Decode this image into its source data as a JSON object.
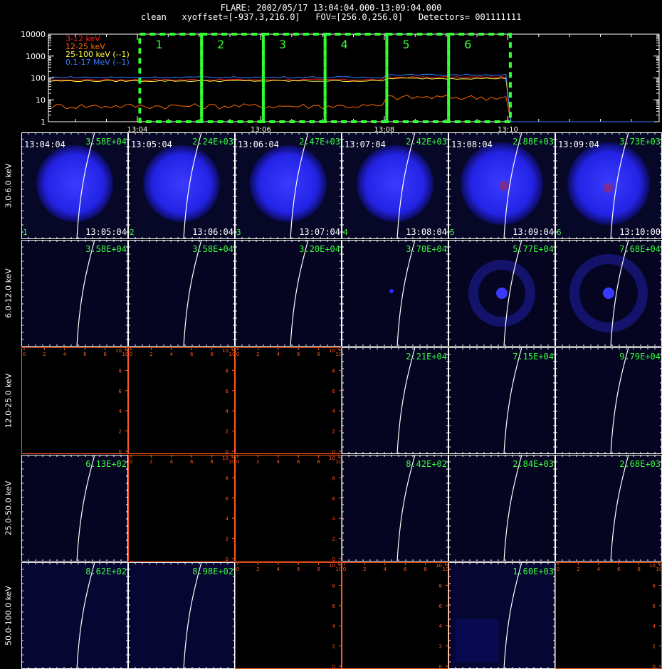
{
  "header": {
    "line1": "FLARE: 2002/05/17 13:04:04.000-13:09:04.000",
    "line2": "clean   xyoffset=[-937.3,216.0]   FOV=[256.0,256.0]   Detectors= 001111111"
  },
  "chart_data": [
    {
      "type": "line",
      "title": "",
      "ylabel": "",
      "yscale": "log",
      "ylim": [
        1,
        10000
      ],
      "y_ticks": [
        "1",
        "10",
        "100",
        "1000",
        "10000"
      ],
      "x_ticks": [
        "13:04",
        "13:06",
        "13:08",
        "13:10"
      ],
      "legend_placement": "top-left",
      "series": [
        {
          "name": "3-12 keV",
          "color": "#ff2020",
          "level": 85
        },
        {
          "name": "12-25 keV",
          "color": "#ff6a00",
          "level": 5
        },
        {
          "name": "25-100 keV (--1)",
          "color": "#ffff40",
          "level": 75
        },
        {
          "name": "0.1-17 MeV (--1)",
          "color": "#3a7bff",
          "level": 110
        }
      ],
      "interval_boxes": [
        "1",
        "2",
        "3",
        "4",
        "5",
        "6"
      ],
      "interval_color": "#33ff33"
    },
    {
      "type": "heatmap",
      "rows": [
        "3.0-6.0 keV",
        "6.0-12.0 keV",
        "12.0-25.0 keV",
        "25.0-50.0 keV",
        "50.0-100.0 keV"
      ],
      "start_times": [
        "13:04:04",
        "13:05:04",
        "13:06:04",
        "13:07:04",
        "13:08:04",
        "13:09:04"
      ],
      "end_times": [
        "13:05:04",
        "13:06:04",
        "13:07:04",
        "13:08:04",
        "13:09:04",
        "13:10:00"
      ],
      "interval_numbers": [
        "1",
        "2",
        "3",
        "4",
        "5",
        "6"
      ],
      "maxima": [
        [
          "3.58E+04",
          "2.24E+03",
          "2.47E+03",
          "2.42E+03",
          "2.88E+03",
          "3.73E+03"
        ],
        [
          "3.58E+04",
          "3.58E+04",
          "3.20E+04",
          "3.70E+04",
          "5.77E+04",
          "7.68E+04"
        ],
        [
          "",
          "",
          "",
          "2.21E+04",
          "7.15E+04",
          "9.79E+04"
        ],
        [
          "6.13E+02",
          "",
          "",
          "8.42E+02",
          "2.84E+03",
          "2.68E+03"
        ],
        [
          "8.62E+02",
          "8.98E+02",
          "",
          "",
          "1.60E+03",
          ""
        ]
      ],
      "empty_axis_ticks": [
        "0",
        "2",
        "4",
        "6",
        "8",
        "10"
      ],
      "empty_cells": [
        [
          2,
          0
        ],
        [
          2,
          1
        ],
        [
          2,
          2
        ],
        [
          3,
          1
        ],
        [
          3,
          2
        ],
        [
          4,
          2
        ],
        [
          4,
          3
        ],
        [
          4,
          5
        ]
      ]
    }
  ]
}
